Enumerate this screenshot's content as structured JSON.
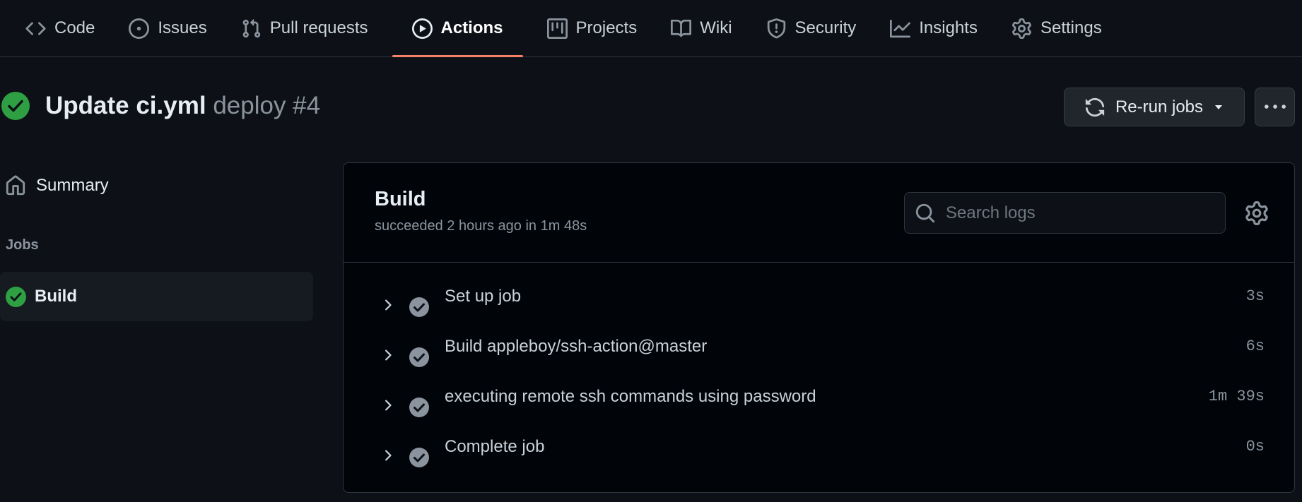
{
  "nav": {
    "tabs": [
      {
        "label": "Code",
        "icon": "code-icon"
      },
      {
        "label": "Issues",
        "icon": "issue-icon"
      },
      {
        "label": "Pull requests",
        "icon": "pull-request-icon"
      },
      {
        "label": "Actions",
        "icon": "play-icon",
        "active": true
      },
      {
        "label": "Projects",
        "icon": "project-icon"
      },
      {
        "label": "Wiki",
        "icon": "book-icon"
      },
      {
        "label": "Security",
        "icon": "shield-icon"
      },
      {
        "label": "Insights",
        "icon": "graph-icon"
      },
      {
        "label": "Settings",
        "icon": "gear-icon"
      }
    ]
  },
  "run": {
    "commit_title": "Update ci.yml",
    "workflow": "deploy #4",
    "status": "success",
    "rerun_label": "Re-run jobs"
  },
  "sidebar": {
    "summary_label": "Summary",
    "jobs_heading": "Jobs",
    "jobs": [
      {
        "label": "Build",
        "status": "success"
      }
    ]
  },
  "job": {
    "name": "Build",
    "meta": "succeeded 2 hours ago in 1m 48s",
    "search_placeholder": "Search logs",
    "steps": [
      {
        "name": "Set up job",
        "duration": "3s"
      },
      {
        "name": "Build appleboy/ssh-action@master",
        "duration": "6s"
      },
      {
        "name": "executing remote ssh commands using password",
        "duration": "1m 39s"
      },
      {
        "name": "Complete job",
        "duration": "0s"
      }
    ]
  },
  "colors": {
    "background": "#0d1117",
    "success": "#2ea043",
    "active_tab_underline": "#f78166",
    "step_check": "#8b949e"
  }
}
